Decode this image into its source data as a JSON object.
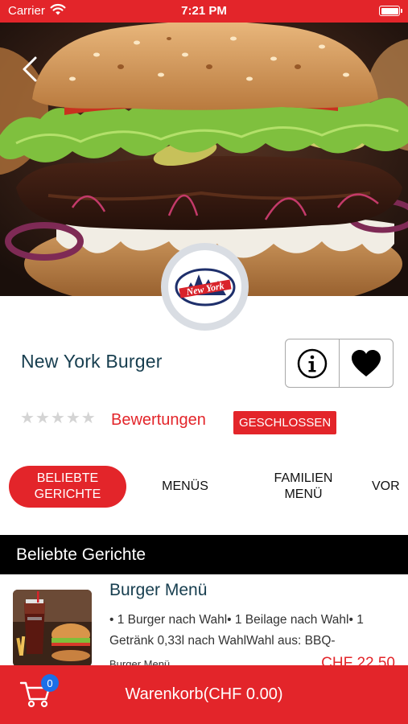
{
  "status_bar": {
    "carrier": "Carrier",
    "time": "7:21 PM"
  },
  "hero": {
    "image": "burger-photo",
    "logo_text": "New York"
  },
  "restaurant": {
    "name": "New York Burger",
    "rating_stars": 0,
    "rating_max": 5,
    "reviews_label": "Bewertungen",
    "status": "GESCHLOSSEN"
  },
  "actions": {
    "info_icon": "info-icon",
    "favorite_icon": "heart-icon"
  },
  "tabs": [
    {
      "label": "BELIEBTE\nGERICHTE",
      "active": true
    },
    {
      "label": "MENÜS",
      "active": false
    },
    {
      "label": "FAMILIEN\nMENÜ",
      "active": false
    },
    {
      "label": "VOR",
      "active": false
    }
  ],
  "section": {
    "title": "Beliebte Gerichte"
  },
  "items": [
    {
      "title": "Burger Menü",
      "description": "• 1 Burger nach Wahl• 1 Beilage nach Wahl• 1 Getränk 0,33l nach WahlWahl aus: BBQ-",
      "category": "Burger Menü",
      "price": "CHF 22.50"
    }
  ],
  "cart": {
    "count": "0",
    "label": "Warenkorb(CHF 0.00)"
  },
  "colors": {
    "brand_red": "#e3252a",
    "title_teal": "#173e4f",
    "badge_blue": "#1c6fe8"
  }
}
